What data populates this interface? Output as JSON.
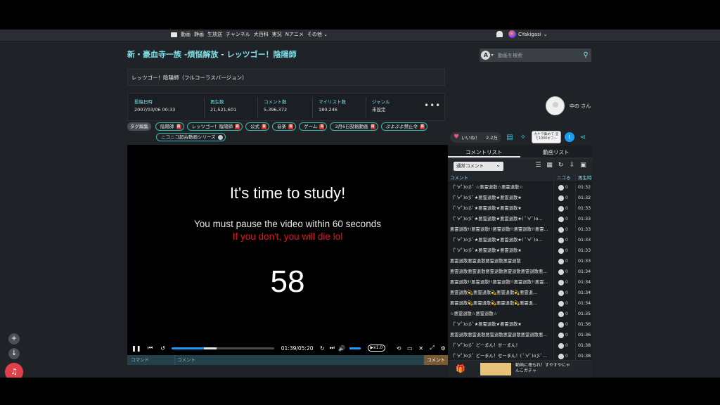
{
  "nav": {
    "items": [
      "動画",
      "静画",
      "生放送",
      "チャンネル",
      "大百科",
      "実況",
      "Nアニメ",
      "その他"
    ],
    "username": "CYakigasi"
  },
  "video": {
    "title": "新・豪血寺一族 -煩悩解放 - レッツゴー！陰陽師",
    "description": "レッツゴー！陰陽師（フルコーラスバージョン）",
    "stats": [
      {
        "label": "投稿日時",
        "value": "2007/03/06 00:33"
      },
      {
        "label": "再生数",
        "value": "21,521,601"
      },
      {
        "label": "コメント数",
        "value": "5,396,372"
      },
      {
        "label": "マイリスト数",
        "value": "180,246"
      },
      {
        "label": "ジャンル",
        "value": "未設定"
      }
    ],
    "more": "•••"
  },
  "search": {
    "placeholder": "動画を検索",
    "a_label": "A",
    "icon": "search-icon"
  },
  "creator": {
    "name": "中の さん"
  },
  "tags": {
    "edit_label": "タグ編集",
    "items": [
      {
        "label": "陰陽師",
        "dic": true
      },
      {
        "label": "レッツゴー！陰陽師",
        "dic": true
      },
      {
        "label": "公式",
        "dic": true
      },
      {
        "label": "音楽",
        "dic": true
      },
      {
        "label": "ゲーム",
        "dic": true
      },
      {
        "label": "3月6日投稿動画",
        "dic": true
      },
      {
        "label": "ぷよぷよ禁止令",
        "dic": true
      },
      {
        "label": "ニコニコ超古動画シリーズ",
        "dic": false
      }
    ]
  },
  "player": {
    "overlay_title": "It's time to study!",
    "overlay_sub": "You must pause the video within 60 seconds",
    "overlay_warn": "If you don't, you will die lol",
    "countdown": "58",
    "time": "01:39/05:20",
    "progress": 0.31,
    "buffered": 0.12,
    "speed": "▶x1.0"
  },
  "command": {
    "cmd_label": "コマンド",
    "comment_placeholder": "コメント",
    "send_label": "コメント"
  },
  "actions": {
    "like_label": "いいね！",
    "like_count": "2.2万",
    "tooltip": "カケラ集めて 全て1000ギフ〜"
  },
  "panel": {
    "tabs": [
      "コメントリスト",
      "動画リスト"
    ],
    "select": "通常コメント",
    "headers": {
      "comment": "コメント",
      "niko": "ニコる",
      "time": "再生時"
    },
    "rows": [
      {
        "text": "（ﾟ∀ﾟ)o彡ﾟ ☆悪霊退散☆悪霊退散☆",
        "n": "0",
        "time": "01:32"
      },
      {
        "text": "（ﾟ∀ﾟ)o彡ﾟ★悪霊退散★悪霊退散★",
        "n": "0",
        "time": "01:32"
      },
      {
        "text": "（ﾟ∀ﾟ)o彡ﾟ★悪霊退散★悪霊退散★",
        "n": "0",
        "time": "01:33"
      },
      {
        "text": "（ﾟ∀ﾟ)o彡ﾟ★悪霊退散★悪霊退散★( ﾟ∀ﾟ)o...",
        "n": "0",
        "time": "01:33"
      },
      {
        "text": "悪霊退散!!悪霊退散!!悪霊退散!!悪霊退散!!悪霊...",
        "n": "0",
        "time": "01:33"
      },
      {
        "text": "（ﾟ∀ﾟ)o彡ﾟ★悪霊退散★悪霊退散★( ﾟ∀ﾟ)o...",
        "n": "0",
        "time": "01:33"
      },
      {
        "text": "（ﾟ∀ﾟ)o彡ﾟ★悪霊退散★悪霊退散★",
        "n": "0",
        "time": "01:33"
      },
      {
        "text": "悪霊退散悪霊退散悪霊退散悪霊退散",
        "n": "0",
        "time": "01:33"
      },
      {
        "text": "悪霊退散悪霊退散悪霊退散悪霊退散悪霊退散悪...",
        "n": "0",
        "time": "01:34"
      },
      {
        "text": "悪霊退散!!悪霊退散!!悪霊退散!!悪霊退散!!悪霊...",
        "n": "0",
        "time": "01:34"
      },
      {
        "text": "悪霊退散💫悪霊退散💫悪霊退散💫悪霊退...",
        "n": "0",
        "time": "01:34"
      },
      {
        "text": "悪霊退散💫悪霊退散💫悪霊退散💫悪霊退...",
        "n": "0",
        "time": "01:34"
      },
      {
        "text": "☆悪霊退散☆悪霊退散☆",
        "n": "0",
        "time": "01:35"
      },
      {
        "text": "（ﾟ∀ﾟ)o彡ﾟ★悪霊退散★悪霊退散★",
        "n": "0",
        "time": "01:36"
      },
      {
        "text": "悪霊退散悪霊退散悪霊退散悪霊退散悪霊退散悪...",
        "n": "0",
        "time": "01:36"
      },
      {
        "text": "（ﾟ∀ﾟ)o彡ﾟ どーまん！せーまん！",
        "n": "0",
        "time": "01:38"
      },
      {
        "text": "（ﾟ∀ﾟ)o彡ﾟ どーまん！せーまん！( ﾟ∀ﾟ)o彡ﾟ...",
        "n": "0",
        "time": "01:38"
      }
    ]
  },
  "ad": {
    "text": "動画に埋もれ！すやすやにゃんこガチャ"
  }
}
